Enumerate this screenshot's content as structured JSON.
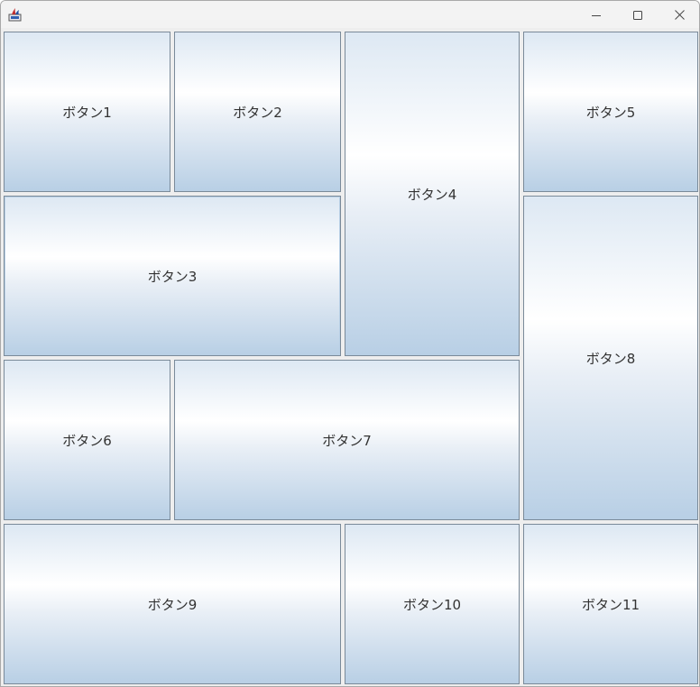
{
  "window": {
    "title": "",
    "icon": "java-coffee-cup-icon",
    "controls": {
      "minimize": "minimize-icon",
      "maximize": "maximize-icon",
      "close": "close-icon"
    }
  },
  "buttons": [
    {
      "label": "ボタン1"
    },
    {
      "label": "ボタン2"
    },
    {
      "label": "ボタン3"
    },
    {
      "label": "ボタン4"
    },
    {
      "label": "ボタン5"
    },
    {
      "label": "ボタン6"
    },
    {
      "label": "ボタン7"
    },
    {
      "label": "ボタン8"
    },
    {
      "label": "ボタン9"
    },
    {
      "label": "ボタン10"
    },
    {
      "label": "ボタン11"
    }
  ],
  "colors": {
    "button_gradient_top": "#dde8f3",
    "button_gradient_mid": "#ffffff",
    "button_gradient_bottom": "#b8cfe5",
    "button_border": "#7a8a99",
    "panel_background": "#eeeeee",
    "titlebar_background": "#f3f3f3"
  }
}
